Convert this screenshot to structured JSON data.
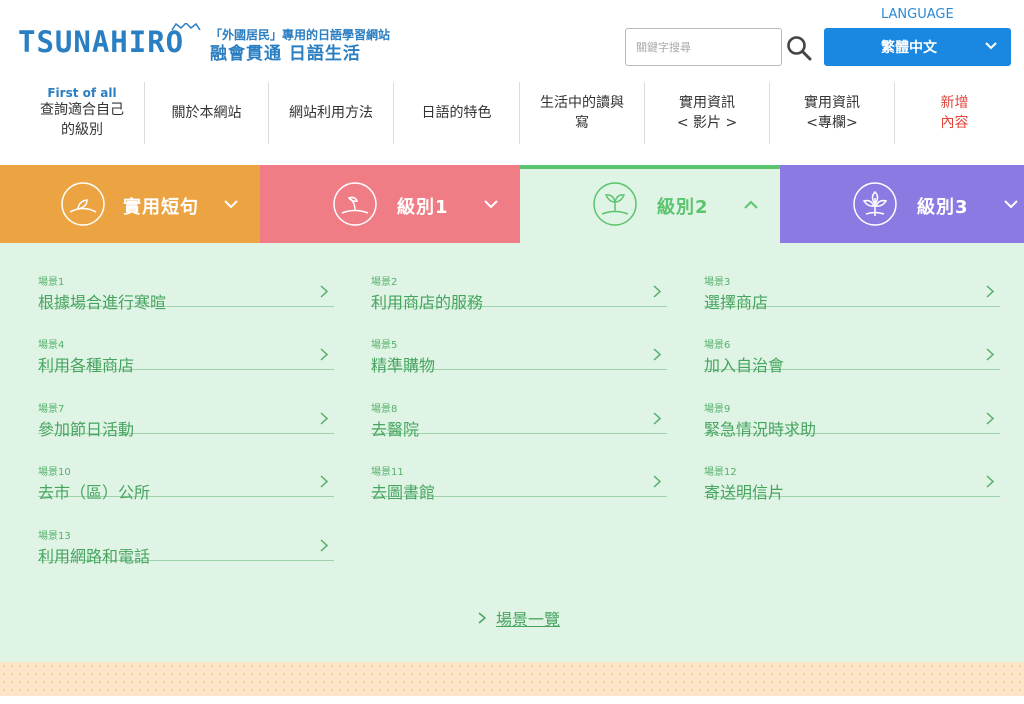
{
  "header": {
    "logo": "TSUNAHIRO",
    "tagline_1": "「外國居民」專用的日語學習網站",
    "tagline_2": "融會貫通 日語生活",
    "search_placeholder": "關鍵字搜尋",
    "language_label": "LANGUAGE",
    "language_value": "繁體中文"
  },
  "nav": {
    "items": [
      {
        "sub": "First of all",
        "label_1": "查詢適合自己",
        "label_2": "的級別"
      },
      {
        "label_1": "關於本網站"
      },
      {
        "label_1": "網站利用方法"
      },
      {
        "label_1": "日語的特色"
      },
      {
        "label_1": "生活中的讀與",
        "label_2": "寫"
      },
      {
        "label_1": "實用資訊",
        "label_2": "< 影片 >"
      },
      {
        "label_1": "實用資訊",
        "label_2": "<專欄>"
      },
      {
        "label_1": "新增",
        "label_2": "內容"
      }
    ]
  },
  "tabs": [
    {
      "label": "實用短句",
      "color": "#eca442",
      "icon": "sprout-seed-icon",
      "state": "collapsed"
    },
    {
      "label": "級別1",
      "color": "#f07c86",
      "icon": "seedling-icon",
      "state": "collapsed"
    },
    {
      "label": "級別2",
      "color": "#5bc46e",
      "icon": "two-leaf-sprout-icon",
      "state": "expanded"
    },
    {
      "label": "級別3",
      "color": "#8c7ae3",
      "icon": "tree-icon",
      "state": "collapsed"
    }
  ],
  "scenes": [
    {
      "num": "場景1",
      "title": "根據場合進行寒暄"
    },
    {
      "num": "場景2",
      "title": "利用商店的服務"
    },
    {
      "num": "場景3",
      "title": "選擇商店"
    },
    {
      "num": "場景4",
      "title": "利用各種商店"
    },
    {
      "num": "場景5",
      "title": "精準購物"
    },
    {
      "num": "場景6",
      "title": "加入自治會"
    },
    {
      "num": "場景7",
      "title": "參加節日活動"
    },
    {
      "num": "場景8",
      "title": "去醫院"
    },
    {
      "num": "場景9",
      "title": "緊急情況時求助"
    },
    {
      "num": "場景10",
      "title": "去市（區）公所"
    },
    {
      "num": "場景11",
      "title": "去圖書館"
    },
    {
      "num": "場景12",
      "title": "寄送明信片"
    },
    {
      "num": "場景13",
      "title": "利用網路和電話"
    }
  ],
  "list_all_label": "場景一覽",
  "colors": {
    "brand_blue": "#2a7ec2",
    "language_button": "#1a87e0",
    "panel_bg": "#dff4e4",
    "scene_text": "#46a45f",
    "new_content": "#e0453b"
  }
}
